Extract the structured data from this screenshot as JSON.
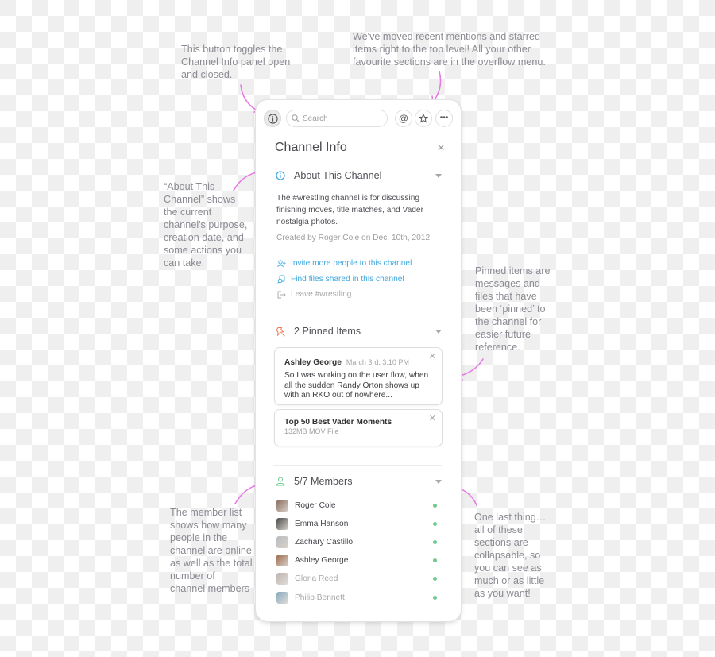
{
  "annotations": {
    "toggle_button": "This button toggles the Channel Info panel open and closed.",
    "top_level": "We've moved recent mentions and starred items right to the top level! All your other favourite sections are in the overflow menu.",
    "about": "“About This Channel” shows the current channel's purpose, creation date, and some actions you can take.",
    "pinned": "Pinned items are messages and files that have been ‘pinned’ to the channel for easier future reference.",
    "members": "The member list shows how many people in the channel are online as well as the total number of channel members",
    "collapsable": "One last thing… all of these sections are collapsable, so you can see as much or as little as you want!"
  },
  "toolbar": {
    "info_icon": "info-circle-icon",
    "search_placeholder": "Search",
    "mentions_icon": "at-sign-icon",
    "starred_icon": "star-icon",
    "overflow_icon": "more-horizontal-icon"
  },
  "panel": {
    "title": "Channel Info",
    "close_icon": "close-icon"
  },
  "about": {
    "heading": "About This Channel",
    "purpose": "The #wrestling channel is for discussing finishing moves, title matches, and Vader nostalgia photos.",
    "created": "Created by Roger Cole on Dec. 10th, 2012.",
    "actions": [
      {
        "icon": "add-user-icon",
        "label": "Invite more people to this channel"
      },
      {
        "icon": "files-icon",
        "label": "Find files shared in this channel"
      },
      {
        "icon": "leave-icon",
        "label": "Leave #wrestling"
      }
    ]
  },
  "pinned": {
    "heading": "2 Pinned Items",
    "items": [
      {
        "author": "Ashley George",
        "time": "March 3rd, 3:10 PM",
        "text": "So I was working on the user flow, when all the sudden Randy Orton shows up with an RKO out of nowhere..."
      },
      {
        "title": "Top 50 Best Vader Moments",
        "meta": "132MB MOV File"
      }
    ]
  },
  "members": {
    "heading": "5/7 Members",
    "list": [
      {
        "name": "Roger Cole",
        "online": true,
        "color": "#8a6a5a"
      },
      {
        "name": "Emma Hanson",
        "online": true,
        "color": "#4a4a4a"
      },
      {
        "name": "Zachary Castillo",
        "online": true,
        "color": "#b9bcc0"
      },
      {
        "name": "Ashley George",
        "online": true,
        "color": "#9c6a4a"
      },
      {
        "name": "Gloria Reed",
        "online": true,
        "color": "#a89a94"
      },
      {
        "name": "Philip Bennett",
        "online": true,
        "color": "#5d8ea6"
      }
    ]
  },
  "colors": {
    "accent_link": "#3ea7de",
    "annotation_arrow": "#e67be6",
    "pin": "#ef7a5a",
    "online": "#72c98d",
    "member_icon": "#72c98d"
  }
}
